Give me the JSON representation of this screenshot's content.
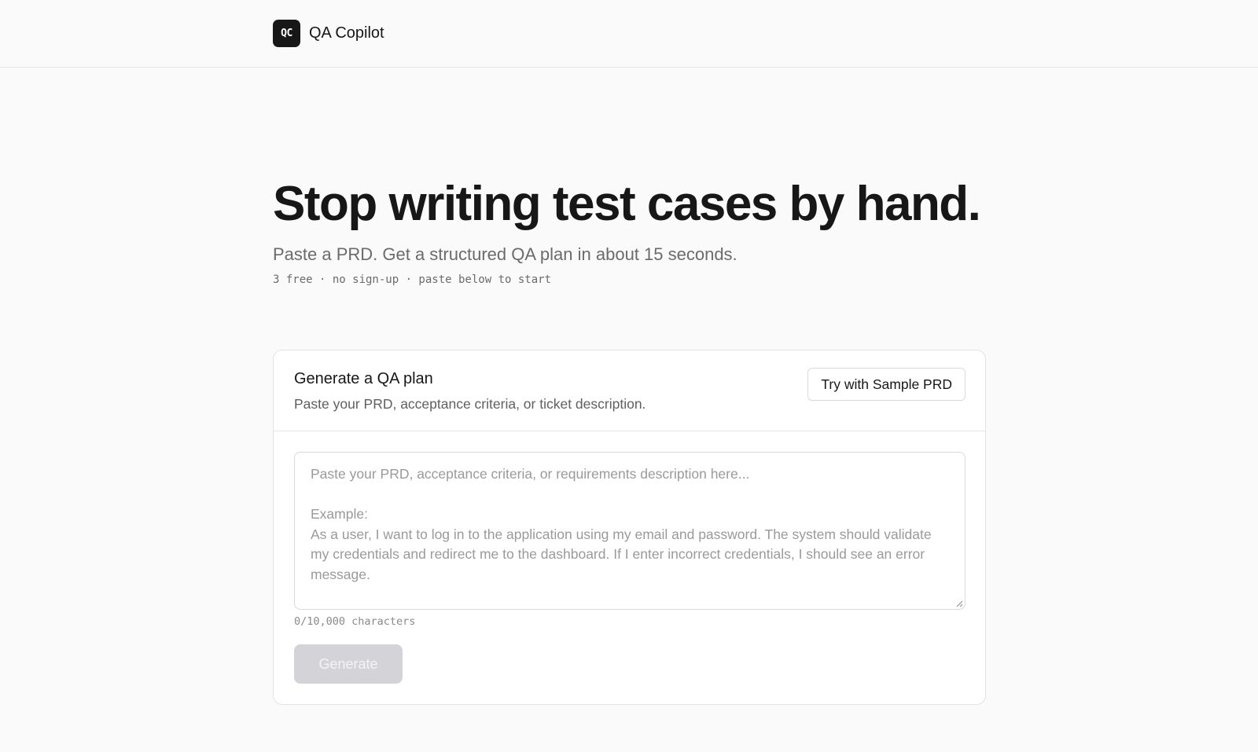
{
  "header": {
    "logo_text": "QC",
    "app_name": "QA Copilot"
  },
  "hero": {
    "title": "Stop writing test cases by hand.",
    "subtitle": "Paste a PRD. Get a structured QA plan in about 15 seconds.",
    "meta": "3 free · no sign-up · paste below to start"
  },
  "form": {
    "title": "Generate a QA plan",
    "description": "Paste your PRD, acceptance criteria, or ticket description.",
    "sample_button": "Try with Sample PRD",
    "textarea_value": "",
    "textarea_placeholder": "Paste your PRD, acceptance criteria, or requirements description here...\n\nExample:\nAs a user, I want to log in to the application using my email and password. The system should validate my credentials and redirect me to the dashboard. If I enter incorrect credentials, I should see an error message.",
    "char_count": "0/10,000 characters",
    "generate_button": "Generate"
  },
  "colors": {
    "background": "#fafafa",
    "text_primary": "#171717",
    "text_muted": "#6b6b6b",
    "button_disabled_bg": "#d4d4d8",
    "logo_bg": "#171717"
  },
  "icons": {
    "resize_handle": "resize-grip-icon"
  }
}
